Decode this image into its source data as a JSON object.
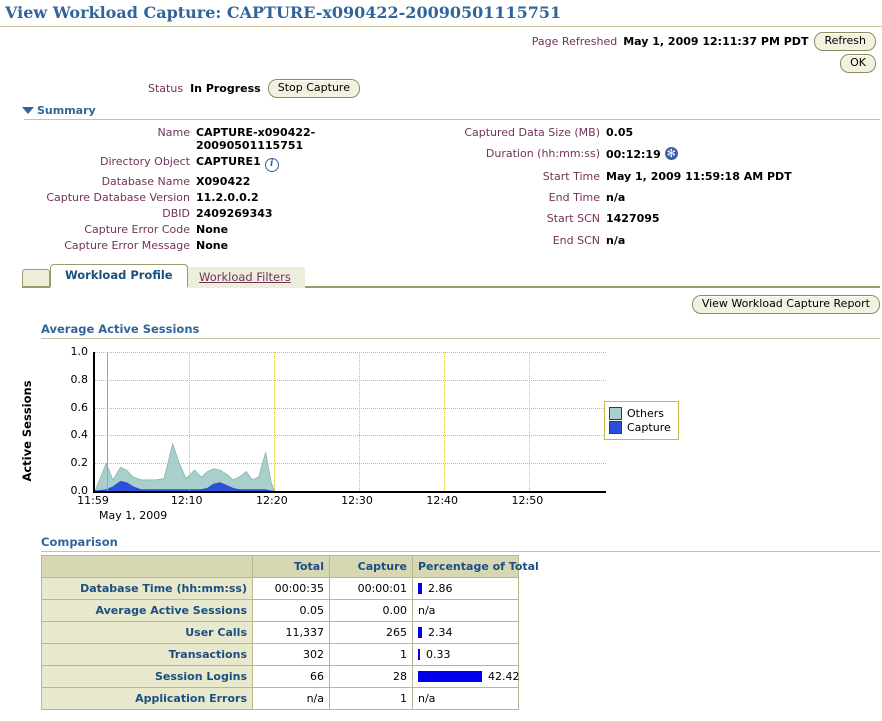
{
  "page": {
    "title": "View Workload Capture: CAPTURE-x090422-20090501115751",
    "refreshed_label": "Page Refreshed",
    "refreshed_value": "May 1, 2009 12:11:37 PM PDT",
    "refresh_button": "Refresh",
    "ok_button": "OK"
  },
  "status": {
    "label": "Status",
    "value": "In Progress",
    "stop_button": "Stop Capture"
  },
  "summary": {
    "title": "Summary",
    "left": [
      {
        "label": "Name",
        "value": "CAPTURE-x090422-",
        "value2": "20090501115751"
      },
      {
        "label": "Directory Object",
        "value": "CAPTURE1",
        "icon": "info-icon"
      },
      {
        "label": "Database Name",
        "value": "X090422"
      },
      {
        "label": "Capture Database Version",
        "value": "11.2.0.0.2"
      },
      {
        "label": "DBID",
        "value": "2409269343"
      },
      {
        "label": "Capture Error Code",
        "value": "None"
      },
      {
        "label": "Capture Error Message",
        "value": "None"
      }
    ],
    "right": [
      {
        "label": "Captured Data Size (MB)",
        "value": "0.05"
      },
      {
        "label": "Duration (hh:mm:ss)",
        "value": "00:12:19",
        "icon": "refresh-spinner-icon"
      },
      {
        "label": "Start Time",
        "value": "May 1, 2009 11:59:18 AM PDT"
      },
      {
        "label": "End Time",
        "value": "n/a"
      },
      {
        "label": "Start SCN",
        "value": "1427095"
      },
      {
        "label": "End SCN",
        "value": "n/a"
      }
    ]
  },
  "tabs": [
    {
      "label": "Workload Profile",
      "active": true
    },
    {
      "label": "Workload Filters",
      "active": false
    }
  ],
  "report_button": "View Workload Capture Report",
  "chart_data": {
    "type": "area",
    "title": "Average Active Sessions",
    "xlabel": "May 1, 2009",
    "ylabel": "Active Sessions",
    "ylim": [
      0,
      1.0
    ],
    "y_ticks": [
      "1.0",
      "0.8",
      "0.6",
      "0.4",
      "0.2",
      "0.0"
    ],
    "x_ticks": [
      "11:59",
      "12:10",
      "12:20",
      "12:30",
      "12:40",
      "12:50"
    ],
    "grid": true,
    "legend_position": "right",
    "stacked": true,
    "colors": {
      "Others": "#a8cfcb",
      "Capture": "#2a4fd8"
    },
    "series": [
      {
        "name": "Others",
        "values": [
          0.0,
          0.19,
          0.05,
          0.1,
          0.09,
          0.07,
          0.07,
          0.07,
          0.07,
          0.08,
          0.33,
          0.19,
          0.08,
          0.14,
          0.09,
          0.12,
          0.11,
          0.09,
          0.08,
          0.06,
          0.09,
          0.13,
          0.07,
          0.09,
          0.27,
          0.06,
          0.0
        ]
      },
      {
        "name": "Capture",
        "values": [
          0.0,
          0.01,
          0.03,
          0.07,
          0.06,
          0.03,
          0.01,
          0.01,
          0.01,
          0.01,
          0.01,
          0.01,
          0.01,
          0.01,
          0.01,
          0.02,
          0.05,
          0.06,
          0.04,
          0.02,
          0.01,
          0.01,
          0.01,
          0.01,
          0.01,
          0.0,
          0.0
        ]
      }
    ],
    "x_fraction": [
      0.0,
      0.022,
      0.035,
      0.05,
      0.062,
      0.075,
      0.09,
      0.105,
      0.12,
      0.135,
      0.152,
      0.165,
      0.178,
      0.195,
      0.208,
      0.22,
      0.232,
      0.245,
      0.258,
      0.27,
      0.282,
      0.296,
      0.308,
      0.32,
      0.334,
      0.345,
      0.352
    ],
    "markers": [
      0.023
    ]
  },
  "comparison": {
    "title": "Comparison",
    "columns": [
      "",
      "Total",
      "Capture",
      "Percentage of Total"
    ],
    "rows": [
      {
        "name": "Database Time (hh:mm:ss)",
        "total": "00:00:35",
        "capture": "00:00:01",
        "pct_text": "2.86",
        "pct_value": 2.86
      },
      {
        "name": "Average Active Sessions",
        "total": "0.05",
        "capture": "0.00",
        "pct_text": "n/a",
        "pct_value": null
      },
      {
        "name": "User Calls",
        "total": "11,337",
        "capture": "265",
        "pct_text": "2.34",
        "pct_value": 2.34
      },
      {
        "name": "Transactions",
        "total": "302",
        "capture": "1",
        "pct_text": "0.33",
        "pct_value": 0.33
      },
      {
        "name": "Session Logins",
        "total": "66",
        "capture": "28",
        "pct_text": "42.42",
        "pct_value": 42.42
      },
      {
        "name": "Application Errors",
        "total": "n/a",
        "capture": "1",
        "pct_text": "n/a",
        "pct_value": null
      }
    ]
  }
}
